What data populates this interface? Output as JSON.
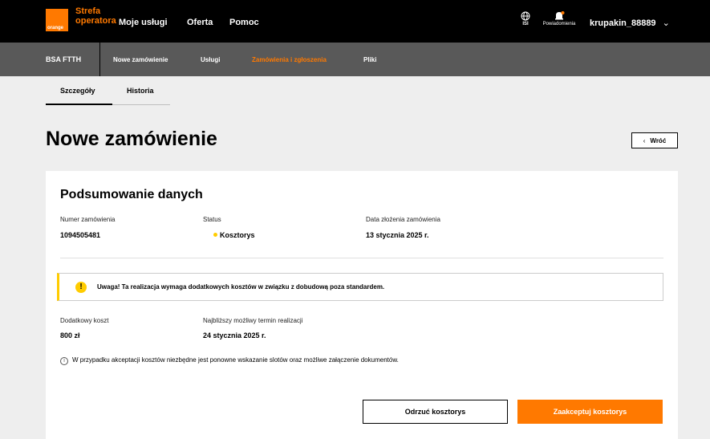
{
  "header": {
    "logo_text": "orange",
    "brand_line1": "Strefa",
    "brand_line2": "operatora",
    "nav": [
      "Moje usługi",
      "Oferta",
      "Pomoc"
    ],
    "lang_label": "ISI",
    "notifications_label": "Powiadomienia",
    "username": "krupakin_88889"
  },
  "subnav": {
    "product": "BSA FTTH",
    "items": [
      "Nowe zamówienie",
      "Usługi",
      "Zamówienia i zgłoszenia",
      "Pliki"
    ],
    "active_index": 2
  },
  "tabs": [
    "Szczegóły",
    "Historia"
  ],
  "page": {
    "title": "Nowe zamówienie",
    "back_label": "Wróć"
  },
  "summary": {
    "title": "Podsumowanie danych",
    "order_number_label": "Numer zamówienia",
    "order_number": "1094505481",
    "status_label": "Status",
    "status": "Kosztorys",
    "date_label": "Data złożenia zamówienia",
    "date": "13 stycznia 2025 r.",
    "warning": "Uwaga! Ta realizacja wymaga dodatkowych kosztów w związku z dobudową poza standardem.",
    "extra_cost_label": "Dodatkowy koszt",
    "extra_cost": "800 zł",
    "earliest_date_label": "Najbliższy możliwy termin realizacji",
    "earliest_date": "24 stycznia 2025 r.",
    "info": "W przypadku akceptacji kosztów niezbędne jest ponowne wskazanie slotów oraz możliwe załączenie dokumentów.",
    "reject_label": "Odrzuć kosztorys",
    "accept_label": "Zaakceptuj kosztorys"
  },
  "colors": {
    "brand": "#ff7900",
    "status_dot": "#ffcc00"
  }
}
